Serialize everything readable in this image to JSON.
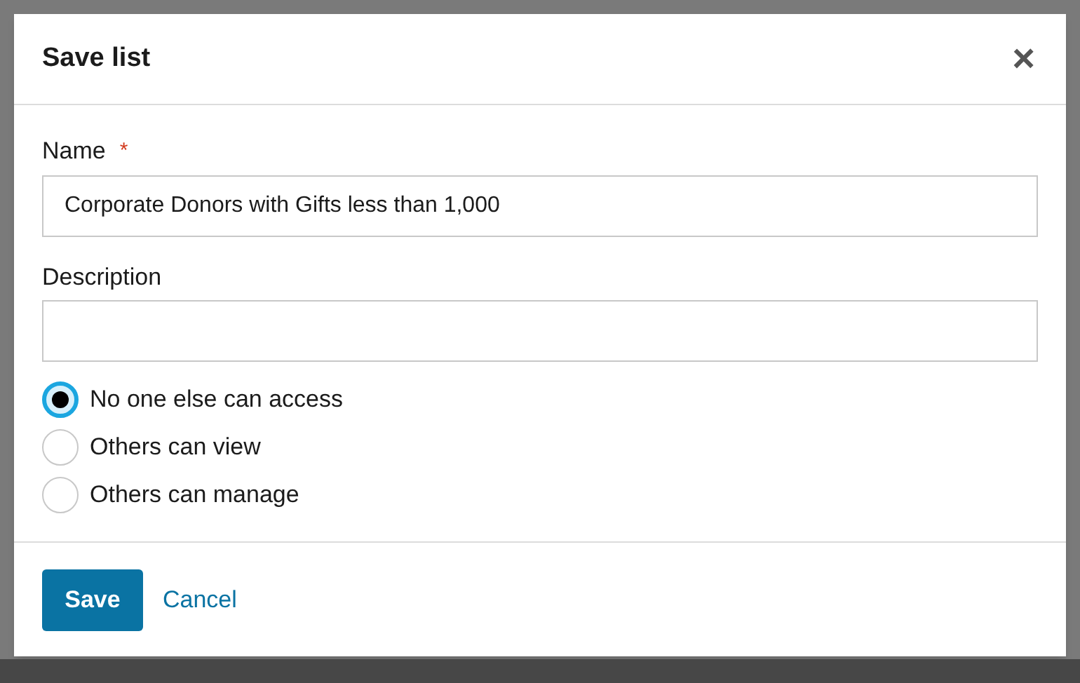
{
  "dialog": {
    "title": "Save list",
    "close": "×"
  },
  "fields": [
    {
      "label": "Name",
      "required_mark": "*",
      "value": "Corporate Donors with Gifts less than 1,000"
    },
    {
      "label": "Description"
    }
  ],
  "access": [
    {
      "label": "No one else can access",
      "selected": true
    },
    {
      "label": "Others can view",
      "selected": false
    },
    {
      "label": "Others can manage",
      "selected": false
    }
  ],
  "buttons": {
    "save": "Save",
    "cancel": "Cancel"
  }
}
